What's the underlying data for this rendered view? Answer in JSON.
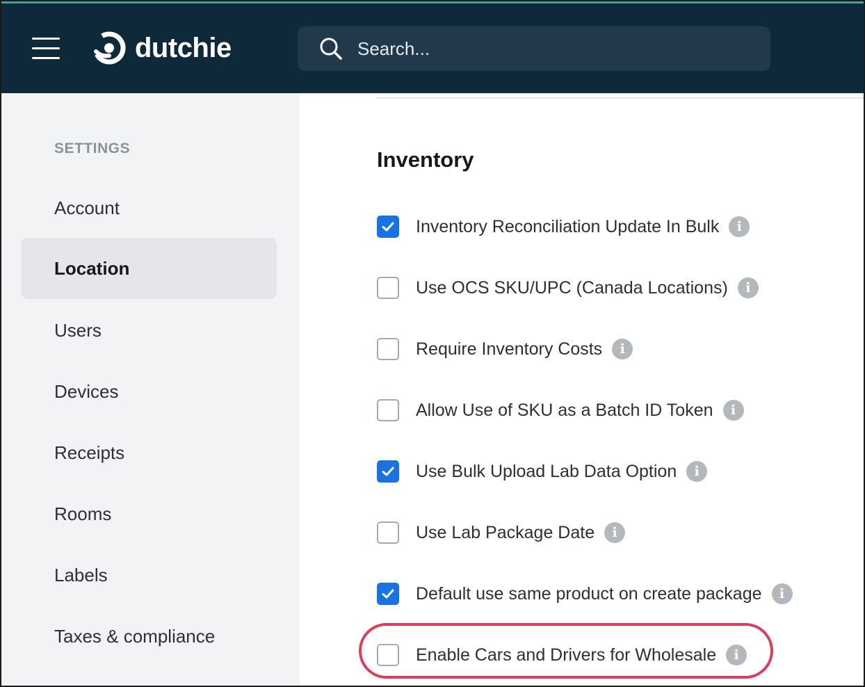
{
  "brand": {
    "name": "dutchie",
    "color": "#0e2a3a",
    "accent": "#3aa6a0"
  },
  "search": {
    "placeholder": "Search..."
  },
  "sidebar": {
    "heading": "SETTINGS",
    "active_color": "#e4e6e9",
    "items": [
      {
        "label": "Account",
        "active": false
      },
      {
        "label": "Location",
        "active": true
      },
      {
        "label": "Users",
        "active": false
      },
      {
        "label": "Devices",
        "active": false
      },
      {
        "label": "Receipts",
        "active": false
      },
      {
        "label": "Rooms",
        "active": false
      },
      {
        "label": "Labels",
        "active": false
      },
      {
        "label": "Taxes & compliance",
        "active": false
      }
    ]
  },
  "main": {
    "section_title": "Inventory",
    "checkbox_color": "#1872e4",
    "info_icon_glyph": "i",
    "highlight_color": "#e23a5a",
    "options": [
      {
        "label": "Inventory Reconciliation Update In Bulk",
        "checked": true
      },
      {
        "label": "Use OCS SKU/UPC (Canada Locations)",
        "checked": false
      },
      {
        "label": "Require Inventory Costs",
        "checked": false
      },
      {
        "label": "Allow Use of SKU as a Batch ID Token",
        "checked": false
      },
      {
        "label": "Use Bulk Upload Lab Data Option",
        "checked": true
      },
      {
        "label": "Use Lab Package Date",
        "checked": false
      },
      {
        "label": "Default use same product on create package",
        "checked": true
      },
      {
        "label": "Enable Cars and Drivers for Wholesale",
        "checked": false,
        "highlighted": true
      }
    ]
  }
}
